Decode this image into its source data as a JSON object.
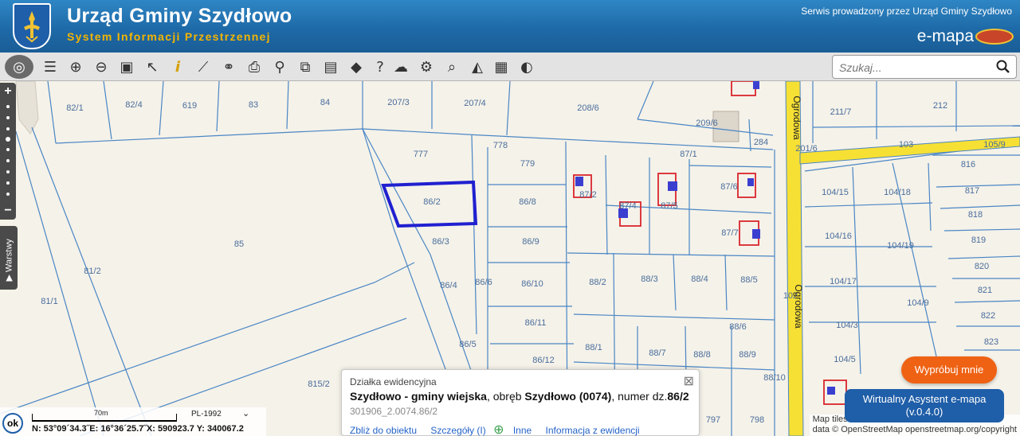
{
  "header": {
    "title": "Urząd Gminy Szydłowo",
    "subtitle": "System Informacji Przestrzennej",
    "serwis": "Serwis prowadzony przez Urząd Gminy Szydłowo",
    "emapa": "e-mapa"
  },
  "toolbar": {
    "tools": [
      {
        "name": "globe-icon",
        "glyph": "◎"
      },
      {
        "name": "layers-icon",
        "glyph": "☰"
      },
      {
        "name": "zoom-in-icon",
        "glyph": "⊕"
      },
      {
        "name": "zoom-out-icon",
        "glyph": "⊖"
      },
      {
        "name": "zoom-extent-icon",
        "glyph": "▣"
      },
      {
        "name": "pointer-icon",
        "glyph": "↖"
      },
      {
        "name": "info-icon",
        "glyph": "i"
      },
      {
        "name": "measure-icon",
        "glyph": "⟋"
      },
      {
        "name": "link-icon",
        "glyph": "⚭"
      },
      {
        "name": "print-icon",
        "glyph": "⎙"
      },
      {
        "name": "marker-icon",
        "glyph": "⚲"
      },
      {
        "name": "copy-icon",
        "glyph": "⧉"
      },
      {
        "name": "panel-icon",
        "glyph": "▤"
      },
      {
        "name": "speech-icon",
        "glyph": "◆"
      },
      {
        "name": "help-icon",
        "glyph": "?"
      },
      {
        "name": "upload-icon",
        "glyph": "☁"
      },
      {
        "name": "settings-icon",
        "glyph": "⚙"
      },
      {
        "name": "search-object-icon",
        "glyph": "⌕"
      },
      {
        "name": "compass-icon",
        "glyph": "◭"
      },
      {
        "name": "palette-icon",
        "glyph": "▦"
      },
      {
        "name": "chat-icon",
        "glyph": "◐"
      }
    ],
    "search_placeholder": "Szukaj..."
  },
  "sidebar": {
    "warstwy": "Warstwy"
  },
  "map": {
    "parcels": [
      {
        "label": "82/1"
      },
      {
        "label": "82/4"
      },
      {
        "label": "619"
      },
      {
        "label": "83"
      },
      {
        "label": "84"
      },
      {
        "label": "207/3"
      },
      {
        "label": "207/4"
      },
      {
        "label": "208/6"
      },
      {
        "label": "209/6"
      },
      {
        "label": "211/7"
      },
      {
        "label": "212"
      },
      {
        "label": "284"
      },
      {
        "label": "87/1"
      },
      {
        "label": "778"
      },
      {
        "label": "777"
      },
      {
        "label": "779"
      },
      {
        "label": "86/2"
      },
      {
        "label": "86/8"
      },
      {
        "label": "87/2"
      },
      {
        "label": "87/4"
      },
      {
        "label": "87/5"
      },
      {
        "label": "87/6"
      },
      {
        "label": "87/7"
      },
      {
        "label": "86/3"
      },
      {
        "label": "86/9"
      },
      {
        "label": "85"
      },
      {
        "label": "86/4"
      },
      {
        "label": "86/6"
      },
      {
        "label": "86/10"
      },
      {
        "label": "88/2"
      },
      {
        "label": "88/3"
      },
      {
        "label": "88/4"
      },
      {
        "label": "88/5"
      },
      {
        "label": "86/11"
      },
      {
        "label": "86/5"
      },
      {
        "label": "88/1"
      },
      {
        "label": "88/7"
      },
      {
        "label": "88/8"
      },
      {
        "label": "88/9"
      },
      {
        "label": "88/6"
      },
      {
        "label": "86/12"
      },
      {
        "label": "81/2"
      },
      {
        "label": "81/1"
      },
      {
        "label": "815/2"
      },
      {
        "label": "797"
      },
      {
        "label": "798"
      },
      {
        "label": "88/10"
      },
      {
        "label": "103"
      },
      {
        "label": "105/9"
      },
      {
        "label": "816"
      },
      {
        "label": "817"
      },
      {
        "label": "818"
      },
      {
        "label": "819"
      },
      {
        "label": "820"
      },
      {
        "label": "821"
      },
      {
        "label": "822"
      },
      {
        "label": "823"
      },
      {
        "label": "104/15"
      },
      {
        "label": "104/18"
      },
      {
        "label": "104/16"
      },
      {
        "label": "104/19"
      },
      {
        "label": "104/17"
      },
      {
        "label": "104/9"
      },
      {
        "label": "104/3"
      },
      {
        "label": "104/5"
      },
      {
        "label": "102"
      },
      {
        "label": "201/6"
      }
    ],
    "streets": [
      "Ogrodowa",
      "Ogrodowa"
    ],
    "selected_parcel": "86/2"
  },
  "popup": {
    "heading": "Działka ewidencyjna",
    "place_bold": "Szydłowo - gminy wiejska",
    "place_mid": ", obręb ",
    "obreb_bold": "Szydłowo (0074)",
    "num_mid": ", numer dz.",
    "num_bold": "86/2",
    "code": "301906_2.0074.86/2",
    "links": [
      "Zbliż do obiektu",
      "Szczegóły (I)",
      "Inne",
      "Informacja z ewidencji"
    ]
  },
  "assistant": {
    "try_label": "Wypróbuj mnie",
    "name": "Wirtualny Asystent e-mapa",
    "version": "(v.0.4.0)"
  },
  "attribution": {
    "line1": "Map tiles",
    "line2": "data © OpenStreetMap",
    "line3": "openstreetmap.org/copyright"
  },
  "scale": {
    "ok": "ok",
    "distance": "70m",
    "projection": "PL-1992",
    "coords": "N: 53°09´34.3˝E: 16°36´25.7˝X: 590923.7 Y: 340067.2"
  },
  "colors": {
    "header": "#1f6aa8",
    "parcel_line": "#4a86c5",
    "road": "#f7e034",
    "selected": "#2020d0",
    "building": "#d9252c",
    "orange": "#ef6214"
  }
}
